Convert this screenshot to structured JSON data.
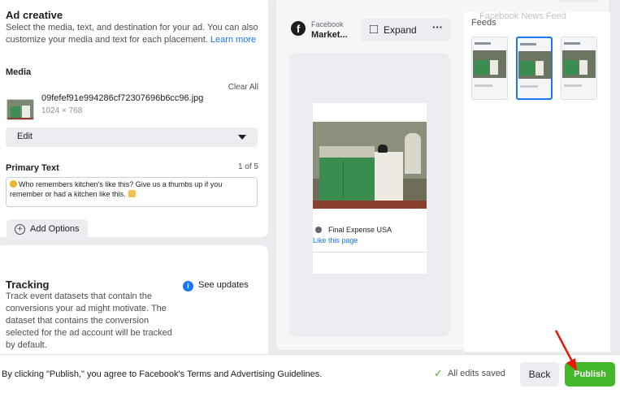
{
  "ad_creative": {
    "title": "Ad creative",
    "description": "Select the media, text, and destination for your ad. You can also customize your media and text for each placement.",
    "learn_more": "Learn more",
    "media_label": "Media",
    "clear_all": "Clear All",
    "media": {
      "file_name": "09fefef91e994286cf72307696b6cc96.jpg",
      "dimensions": "1024 × 768"
    },
    "edit_select": {
      "value": "Edit"
    },
    "primary_text": {
      "label": "Primary Text",
      "counter": "1 of 5",
      "value": "Who remembers kitchen's like this? Give us a thumbs up if you remember or had a kitchen like this."
    },
    "add_options": "Add Options"
  },
  "tracking": {
    "title": "Tracking",
    "description": "Track event datasets that contain the conversions your ad might motivate. The dataset that contains the conversion selected for the ad account will be tracked by default.",
    "see_updates": "See updates"
  },
  "preview": {
    "platform_small": "Facebook",
    "platform_main": "Market...",
    "expand_label": "Expand",
    "more_label": "···",
    "page_name": "Final Expense USA",
    "like_page": "Like this page",
    "feeds_label": "Feeds",
    "feeds_tooltip": "Facebook News Feed",
    "thumbnails": [
      {
        "name": "feed-placement-1",
        "selected": false
      },
      {
        "name": "feed-placement-2",
        "selected": true
      },
      {
        "name": "feed-placement-3",
        "selected": false
      }
    ]
  },
  "footer": {
    "terms_text": "By clicking \"Publish,\" you agree to Facebook's Terms and Advertising Guidelines.",
    "saved_status": "All edits saved",
    "back_label": "Back",
    "publish_label": "Publish"
  },
  "colors": {
    "accent": "#1877f2",
    "publish_green": "#42b72a",
    "annotation_red": "#e8190c"
  },
  "icons": [
    "facebook-logo-icon",
    "expand-icon",
    "more-icon",
    "info-icon",
    "plus-circle-icon",
    "check-icon",
    "chevron-down-icon",
    "red-arrow-annotation"
  ]
}
